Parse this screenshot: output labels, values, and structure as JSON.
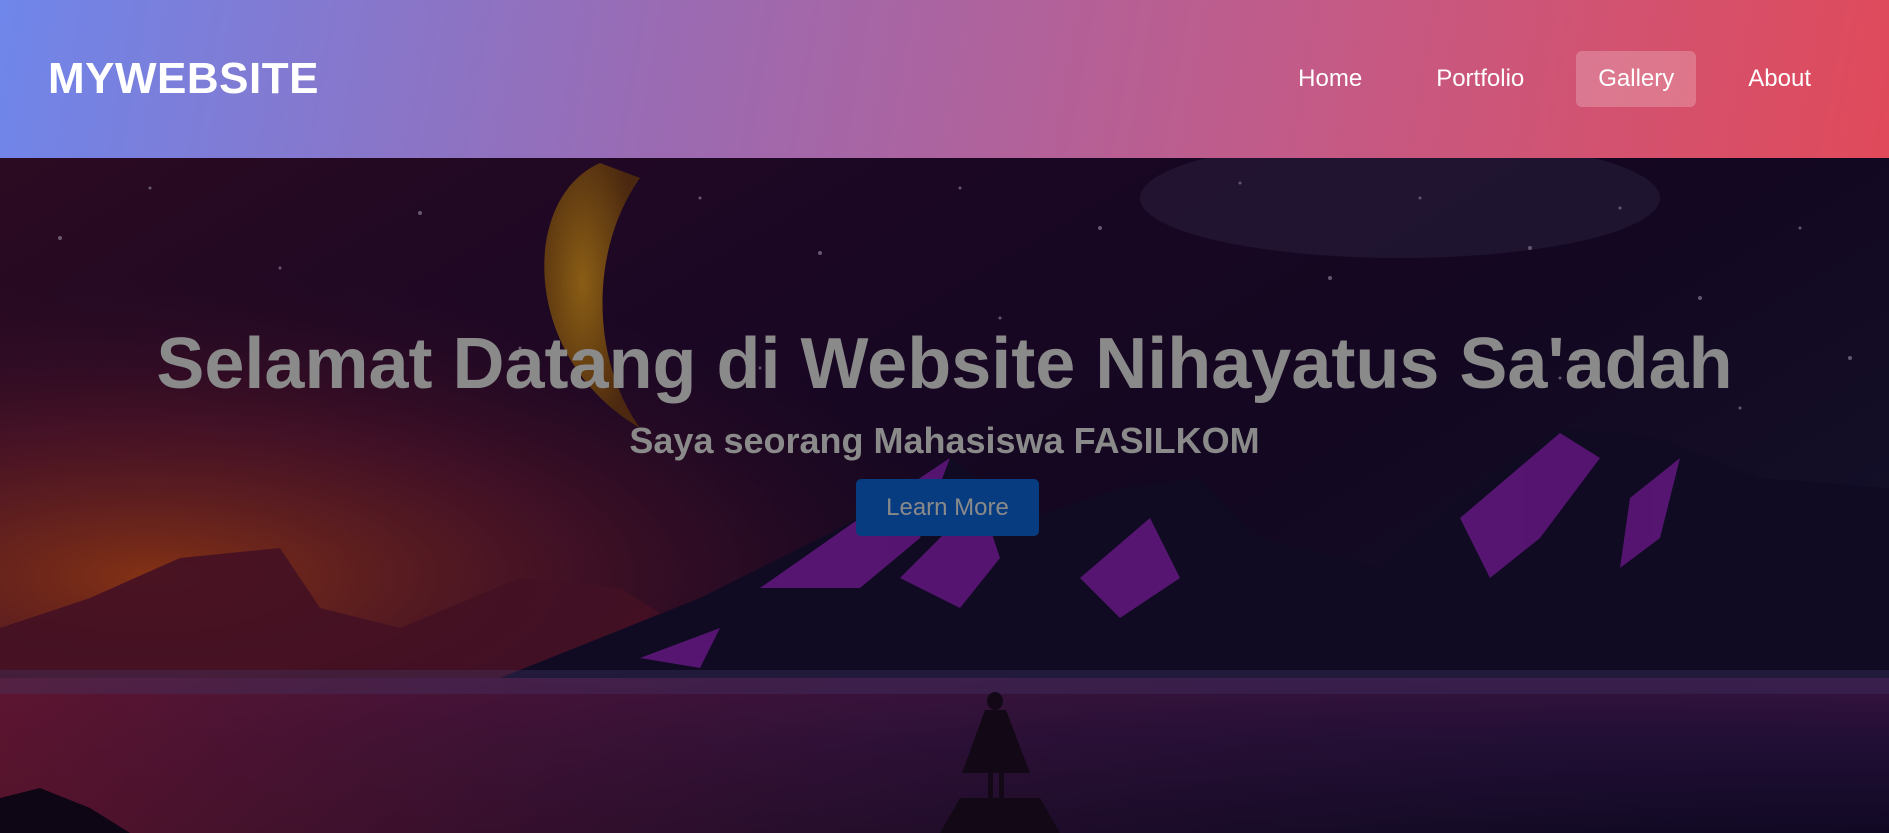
{
  "header": {
    "logo": "MYWEBSITE",
    "nav": [
      {
        "label": "Home"
      },
      {
        "label": "Portfolio"
      },
      {
        "label": "Gallery",
        "active": true
      },
      {
        "label": "About"
      }
    ]
  },
  "hero": {
    "title": "Selamat Datang di Website Nihayatus Sa'adah",
    "subtitle": "Saya seorang Mahasiswa FASILKOM",
    "button_label": "Learn More"
  },
  "colors": {
    "header_gradient_start": "#6f86ea",
    "header_gradient_end": "#e04a5a",
    "button_bg": "#083c80",
    "hero_text": "#8a8a8a"
  }
}
